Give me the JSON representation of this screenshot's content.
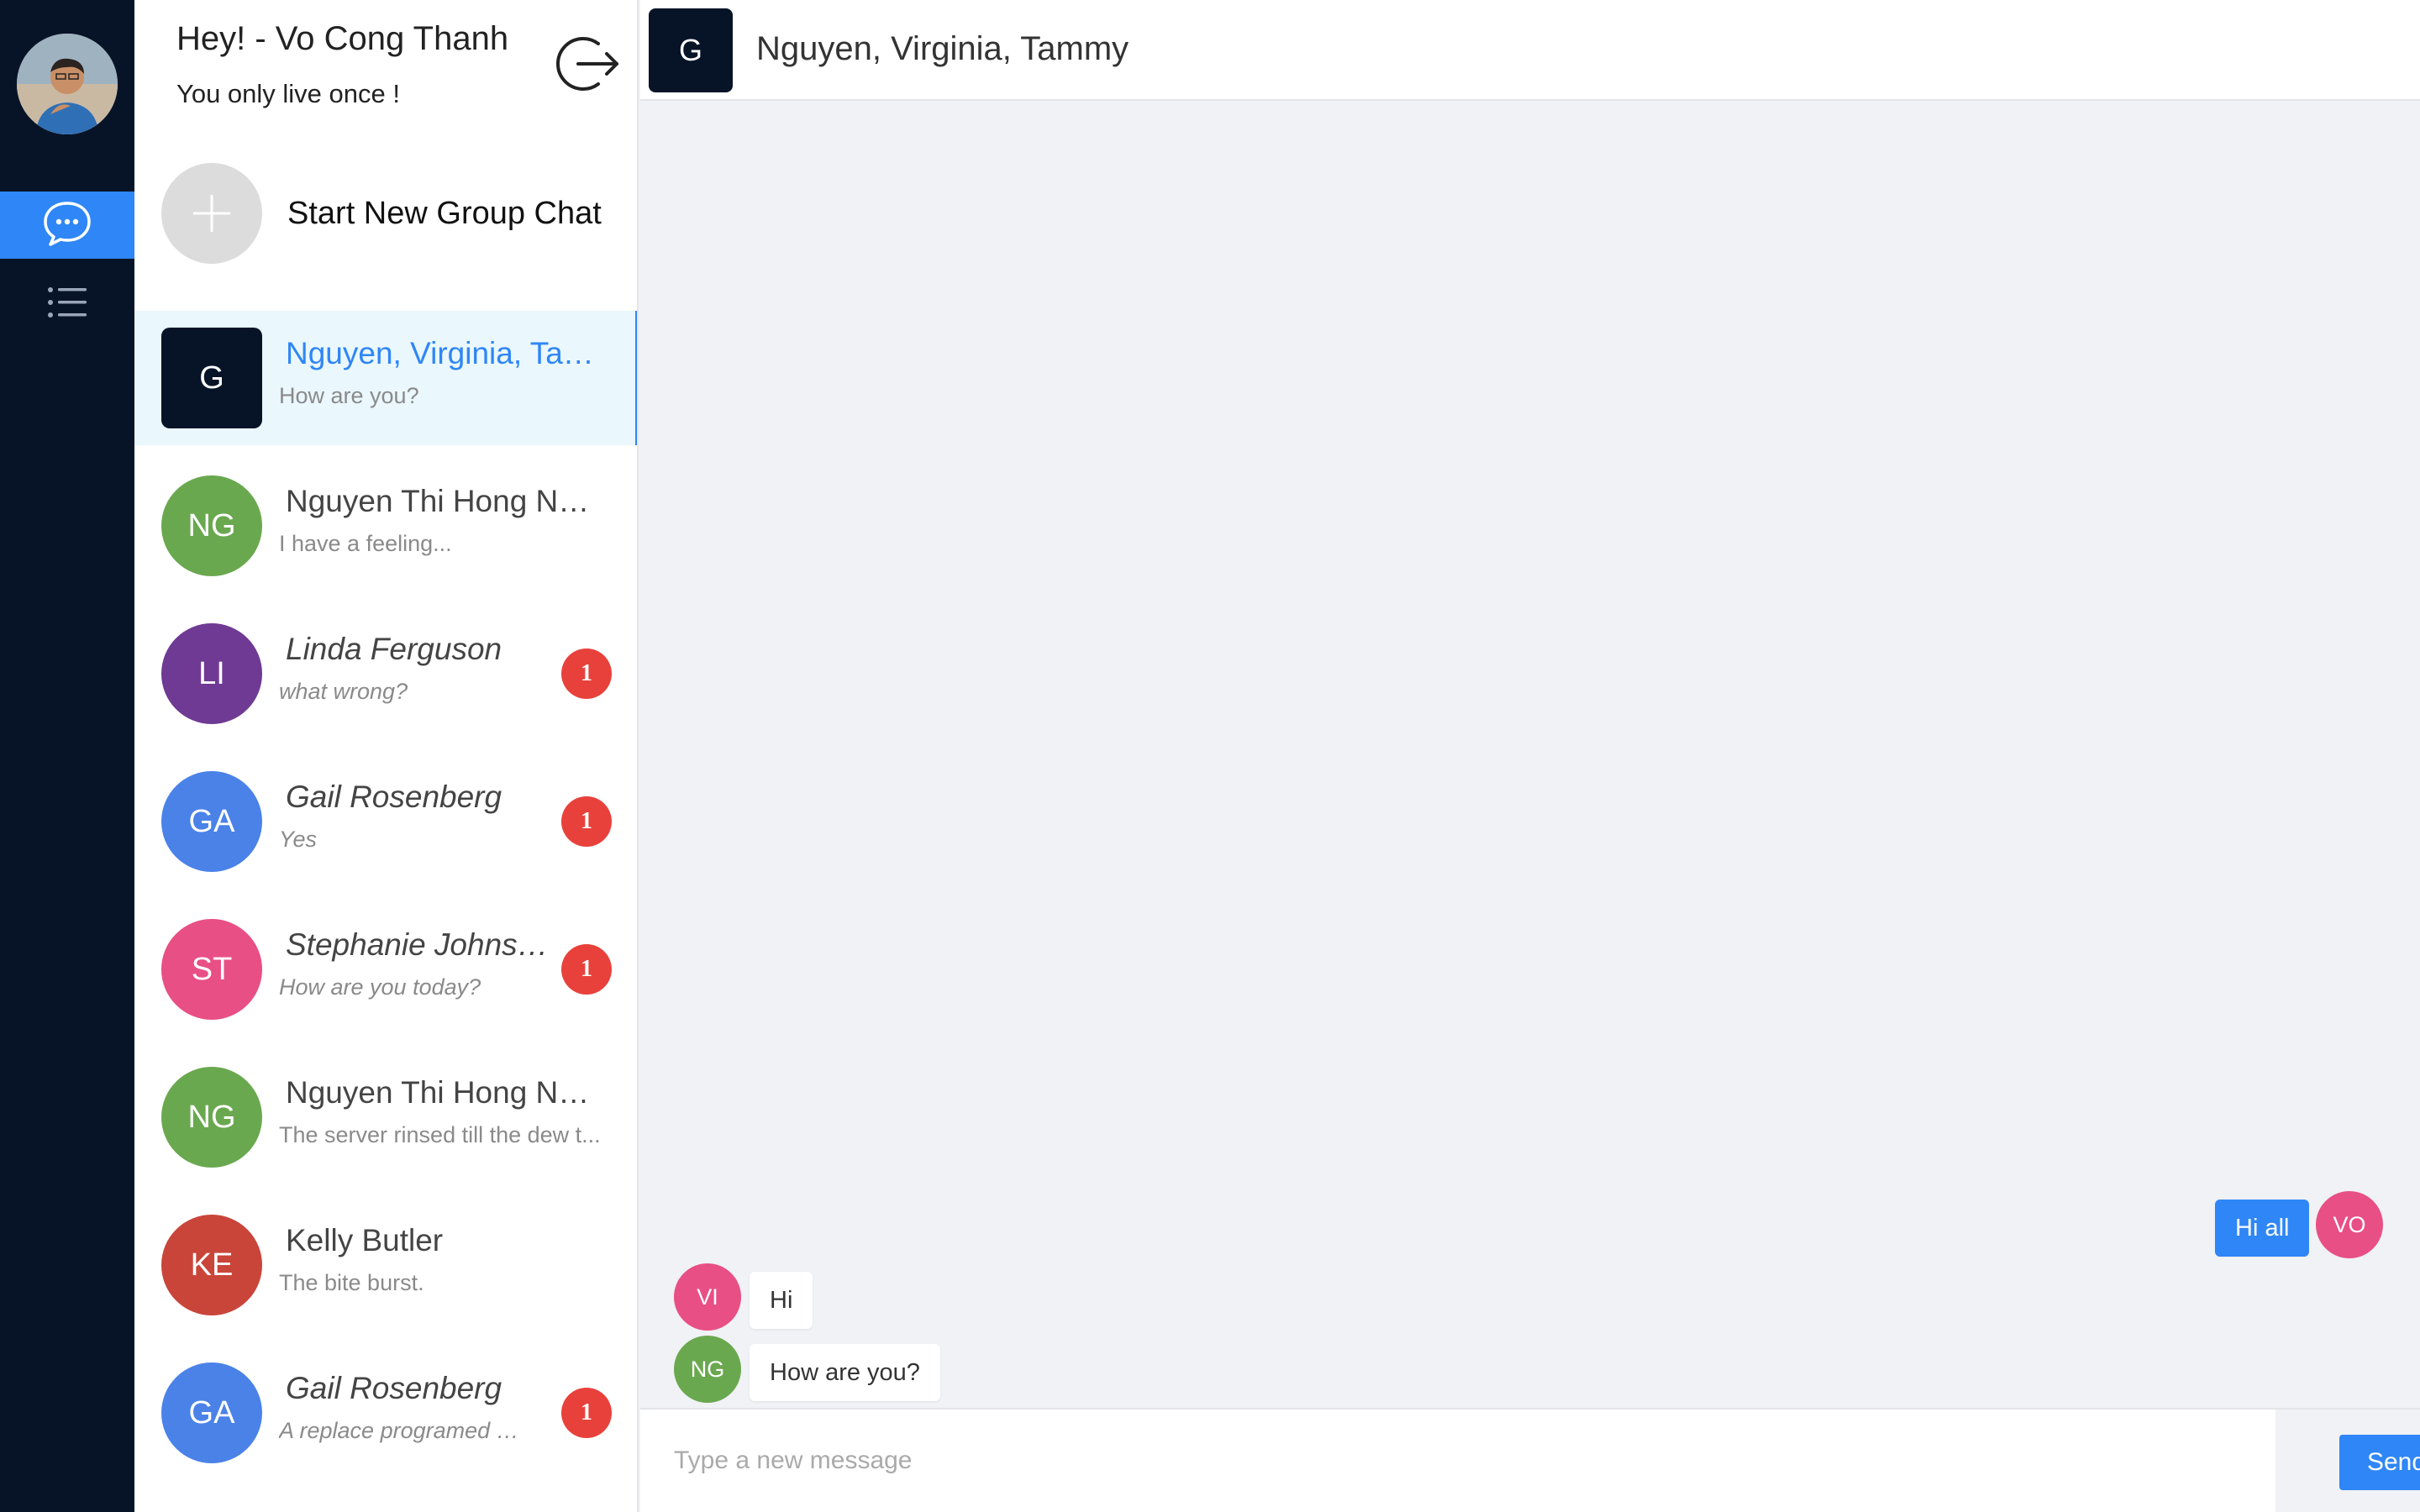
{
  "user": {
    "greeting": "Hey! - Vo Cong Thanh",
    "motto": "You only live once !"
  },
  "nav": {
    "items": [
      {
        "icon": "chat-bubble-icon",
        "active": true
      },
      {
        "icon": "list-icon",
        "active": false
      }
    ]
  },
  "new_group": {
    "label": "Start New Group Chat"
  },
  "conversations": [
    {
      "initials": "G",
      "name": "Nguyen, Virginia, Tammy",
      "preview": "How are you?",
      "color": "#071428",
      "square": true,
      "selected": true,
      "unread": null
    },
    {
      "initials": "NG",
      "name": "Nguyen Thi Hong Nhung",
      "preview": "I have a feeling...",
      "color": "#6aa84f",
      "unread": null
    },
    {
      "initials": "LI",
      "name": "Linda Ferguson",
      "preview": "what wrong?",
      "color": "#6f3a94",
      "unread": "1"
    },
    {
      "initials": "GA",
      "name": "Gail Rosenberg",
      "preview": "Yes",
      "color": "#4a82e8",
      "unread": "1"
    },
    {
      "initials": "ST",
      "name": "Stephanie Johnston",
      "preview": "How are you today?",
      "color": "#e84f84",
      "unread": "1"
    },
    {
      "initials": "NG",
      "name": "Nguyen Thi Hong Nhung",
      "preview": "The server rinsed till the dew t...",
      "color": "#6aa84f",
      "unread": null
    },
    {
      "initials": "KE",
      "name": "Kelly Butler",
      "preview": "The bite burst.",
      "color": "#c9453a",
      "unread": null
    },
    {
      "initials": "GA",
      "name": "Gail Rosenberg",
      "preview": "A replace programed off ...",
      "color": "#4a82e8",
      "unread": "1"
    }
  ],
  "chat": {
    "avatar_initials": "G",
    "title": "Nguyen, Virginia, Tammy",
    "messages": [
      {
        "from": "VO",
        "text": "Hi all",
        "outgoing": true,
        "avatar_color": "#e84f84"
      },
      {
        "from": "VI",
        "text": "Hi",
        "outgoing": false,
        "avatar_color": "#e84f84"
      },
      {
        "from": "NG",
        "text": "How are you?",
        "outgoing": false,
        "avatar_color": "#6aa84f"
      }
    ]
  },
  "composer": {
    "placeholder": "Type a new message",
    "send_label": "Send"
  },
  "colors": {
    "accent": "#2f86f6",
    "rail": "#071428",
    "badge": "#e8413b"
  }
}
